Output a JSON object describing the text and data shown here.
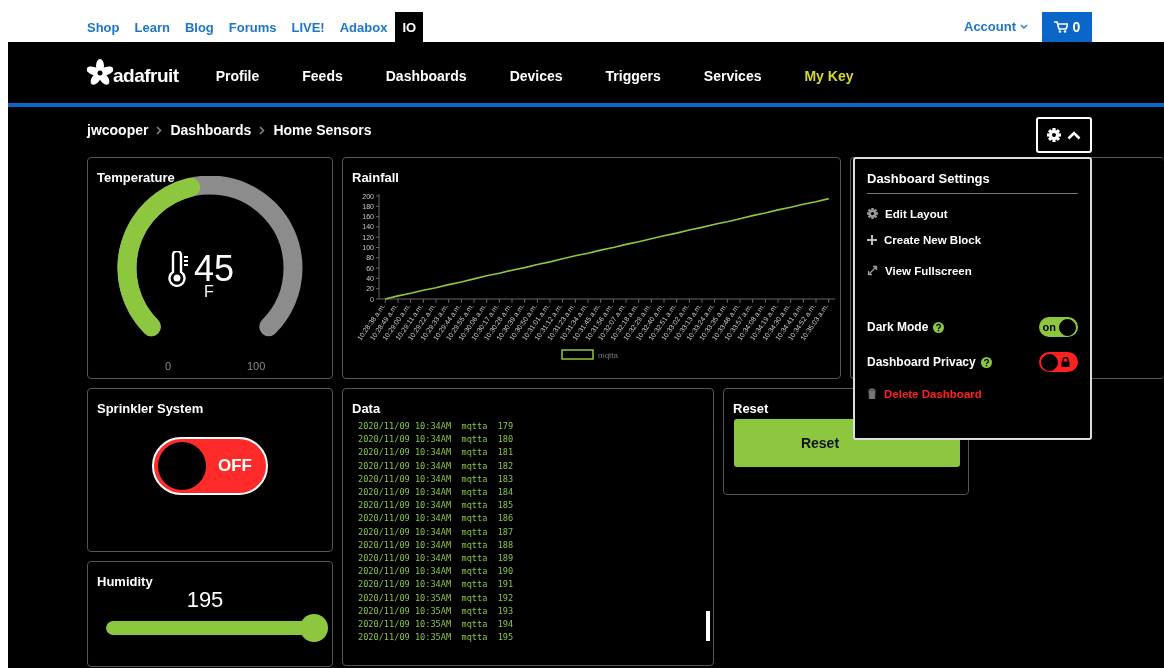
{
  "top_links": [
    {
      "label": "Shop",
      "selected": false
    },
    {
      "label": "Learn",
      "selected": false
    },
    {
      "label": "Blog",
      "selected": false
    },
    {
      "label": "Forums",
      "selected": false
    },
    {
      "label": "LIVE!",
      "selected": false
    },
    {
      "label": "Adabox",
      "selected": false
    },
    {
      "label": "IO",
      "selected": true
    }
  ],
  "account": {
    "label": "Account"
  },
  "cart": {
    "count": "0"
  },
  "logo": {
    "text": "adafruit"
  },
  "nav": [
    {
      "label": "Profile",
      "highlighted": false
    },
    {
      "label": "Feeds",
      "highlighted": false
    },
    {
      "label": "Dashboards",
      "highlighted": false
    },
    {
      "label": "Devices",
      "highlighted": false
    },
    {
      "label": "Triggers",
      "highlighted": false
    },
    {
      "label": "Services",
      "highlighted": false
    },
    {
      "label": "My Key",
      "highlighted": true
    }
  ],
  "breadcrumbs": [
    "jwcooper",
    "Dashboards",
    "Home Sensors"
  ],
  "settings_menu": {
    "expanded": true,
    "title": "Dashboard Settings",
    "items": [
      {
        "kind": "action",
        "label": "Edit Layout",
        "danger": false
      },
      {
        "kind": "action",
        "label": "Create New Block",
        "danger": false
      },
      {
        "kind": "action",
        "label": "View Fullscreen",
        "danger": false
      },
      {
        "kind": "toggle",
        "label": "Dark Mode",
        "on": true,
        "toggle_text": "on"
      },
      {
        "kind": "toggle",
        "label": "Dashboard Privacy",
        "on": false
      },
      {
        "kind": "action",
        "label": "Delete Dashboard",
        "danger": true
      }
    ]
  },
  "temperature": {
    "title": "Temperature",
    "value": "45",
    "unit": "F",
    "min": "0",
    "max": "100"
  },
  "rainfall": {
    "chart_data": {
      "type": "line",
      "title": "Rainfall",
      "categories": [
        "10:28:38 a.m.",
        "10:28:49 a.m.",
        "10:29:00 a.m.",
        "10:29:11 a.m.",
        "10:29:22 a.m.",
        "10:29:33 a.m.",
        "10:29:44 a.m.",
        "10:29:55 a.m.",
        "10:30:06 a.m.",
        "10:30:17 a.m.",
        "10:30:28 a.m.",
        "10:30:39 a.m.",
        "10:30:50 a.m.",
        "10:31:01 a.m.",
        "10:31:12 a.m.",
        "10:31:23 a.m.",
        "10:31:34 a.m.",
        "10:31:45 a.m.",
        "10:31:56 a.m.",
        "10:32:07 a.m.",
        "10:32:18 a.m.",
        "10:32:29 a.m.",
        "10:32:40 a.m.",
        "10:32:51 a.m.",
        "10:33:02 a.m.",
        "10:33:13 a.m.",
        "10:33:24 a.m.",
        "10:33:35 a.m.",
        "10:33:46 a.m.",
        "10:33:57 a.m.",
        "10:34:08 a.m.",
        "10:34:19 a.m.",
        "10:34:30 a.m.",
        "10:34:41 a.m.",
        "10:34:52 a.m.",
        "10:35:03 a.m."
      ],
      "series": [
        {
          "name": "mqtta",
          "color": "#8dc63f",
          "values": [
            0,
            6,
            11,
            17,
            22,
            28,
            33,
            39,
            45,
            50,
            56,
            61,
            67,
            72,
            78,
            84,
            89,
            95,
            100,
            106,
            111,
            117,
            123,
            128,
            134,
            139,
            145,
            150,
            156,
            162,
            167,
            173,
            178,
            184,
            189,
            195
          ]
        }
      ],
      "ylim": [
        0,
        200
      ],
      "yticks": [
        0,
        20,
        40,
        60,
        80,
        100,
        120,
        140,
        160,
        180,
        200
      ]
    }
  },
  "sprinkler": {
    "title": "Sprinkler System",
    "on": false,
    "label": "OFF"
  },
  "data_log": {
    "title": "Data",
    "rows": [
      "2020/11/09 10:34AM  mqtta  179",
      "2020/11/09 10:34AM  mqtta  180",
      "2020/11/09 10:34AM  mqtta  181",
      "2020/11/09 10:34AM  mqtta  182",
      "2020/11/09 10:34AM  mqtta  183",
      "2020/11/09 10:34AM  mqtta  184",
      "2020/11/09 10:34AM  mqtta  185",
      "2020/11/09 10:34AM  mqtta  186",
      "2020/11/09 10:34AM  mqtta  187",
      "2020/11/09 10:34AM  mqtta  188",
      "2020/11/09 10:34AM  mqtta  189",
      "2020/11/09 10:34AM  mqtta  190",
      "2020/11/09 10:34AM  mqtta  191",
      "2020/11/09 10:35AM  mqtta  192",
      "2020/11/09 10:35AM  mqtta  193",
      "2020/11/09 10:35AM  mqtta  194",
      "2020/11/09 10:35AM  mqtta  195"
    ]
  },
  "reset": {
    "title": "Reset",
    "button": "Reset"
  },
  "humidity": {
    "title": "Humidity",
    "value": "195",
    "level": 0.97
  }
}
